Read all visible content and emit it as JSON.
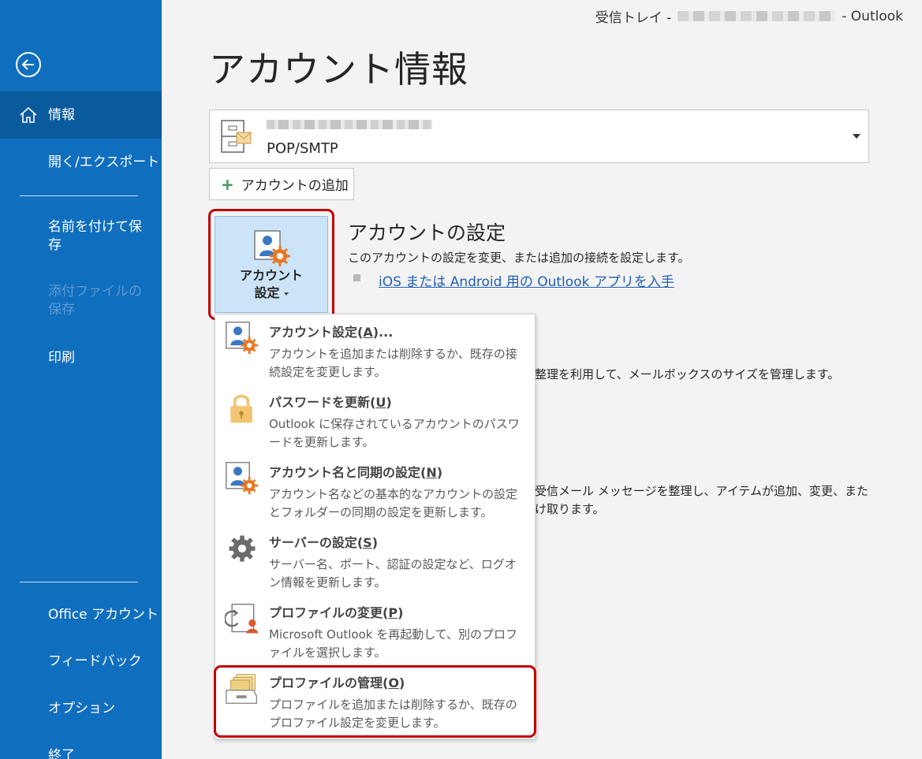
{
  "titlebar": {
    "prefix": "受信トレイ -",
    "suffix": "-  Outlook"
  },
  "sidebar": {
    "info": "情報",
    "open_export": "開く/エクスポート",
    "save_as": "名前を付けて保存",
    "save_attachments": "添付ファイルの保存",
    "print": "印刷",
    "office_account": "Office アカウント",
    "feedback": "フィードバック",
    "options": "オプション",
    "exit": "終了"
  },
  "page_title": "アカウント情報",
  "account": {
    "type": "POP/SMTP"
  },
  "add_account_label": "アカウントの追加",
  "settings_button": {
    "line1": "アカウント",
    "line2": "設定"
  },
  "account_settings": {
    "title": "アカウントの設定",
    "description": "このアカウントの設定を変更、または追加の接続を設定します。",
    "link": "iOS または Android 用の Outlook アプリを入手"
  },
  "background": {
    "line1": "整理を利用して、メールボックスのサイズを管理します。",
    "line2": "受信メール メッセージを整理し、アイテムが追加、変更、また",
    "line3": "け取ります。"
  },
  "menu": {
    "items": [
      {
        "title": "アカウント設定(",
        "key": "A",
        "suffix": ")...",
        "desc": "アカウントを追加または削除するか、既存の接続設定を変更します。",
        "icon": "account-settings-icon"
      },
      {
        "title": "パスワードを更新(",
        "key": "U",
        "suffix": ")",
        "desc": "Outlook に保存されているアカウントのパスワードを更新します。",
        "icon": "lock-icon"
      },
      {
        "title": "アカウント名と同期の設定(",
        "key": "N",
        "suffix": ")",
        "desc": "アカウント名などの基本的なアカウントの設定とフォルダーの同期の設定を更新します。",
        "icon": "account-sync-icon"
      },
      {
        "title": "サーバーの設定(",
        "key": "S",
        "suffix": ")",
        "desc": "サーバー名、ポート、認証の設定など、ログオン情報を更新します。",
        "icon": "gear-icon"
      },
      {
        "title": "プロファイルの変更(",
        "key": "P",
        "suffix": ")",
        "desc": "Microsoft Outlook を再起動して、別のプロファイルを選択します。",
        "icon": "change-profile-icon"
      },
      {
        "title": "プロファイルの管理(",
        "key": "O",
        "suffix": ")",
        "desc": "プロファイルを追加または削除するか、既存のプロファイル設定を変更します。",
        "icon": "manage-profiles-icon"
      }
    ]
  },
  "colors": {
    "sidebar": "#106ebe",
    "active": "#0a5a9e",
    "highlight": "#c00000",
    "link": "#1f5fb4"
  }
}
